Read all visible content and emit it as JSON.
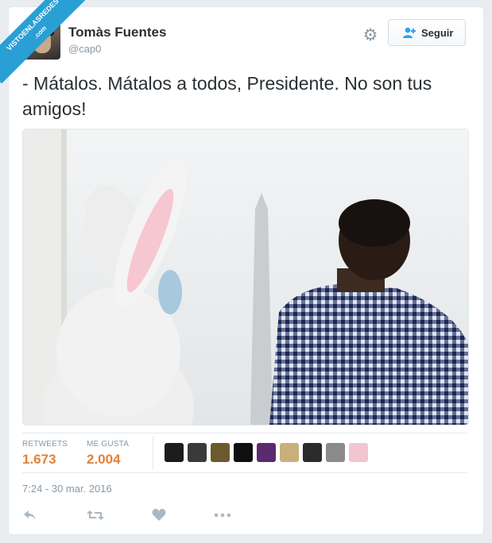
{
  "watermark": {
    "line1": "VISTOENLASREDES",
    "line2": ".com"
  },
  "user": {
    "name": "Tomàs Fuentes",
    "handle": "@cap0"
  },
  "header": {
    "settings_icon": "gear-icon",
    "follow_label": "Seguir",
    "follow_icon": "add-user-icon"
  },
  "tweet": {
    "text": "- Mátalos. Mátalos a todos, Presidente. No son tus amigos!"
  },
  "stats": {
    "retweets_label": "RETWEETS",
    "retweets_value": "1.673",
    "likes_label": "ME GUSTA",
    "likes_value": "2.004"
  },
  "liked_by_avatars": [
    {
      "color": "#1c1c1c"
    },
    {
      "color": "#3a3a3a"
    },
    {
      "color": "#6b5a2e"
    },
    {
      "color": "#0f0f0f"
    },
    {
      "color": "#5b2a6e"
    },
    {
      "color": "#c9b07a"
    },
    {
      "color": "#2b2b2b"
    },
    {
      "color": "#8a8a8a"
    },
    {
      "color": "#f3c4d2"
    }
  ],
  "timestamp": "7:24 - 30 mar. 2016",
  "actions": {
    "reply_icon": "reply-icon",
    "retweet_icon": "retweet-icon",
    "like_icon": "heart-icon",
    "more_icon": "more-icon"
  },
  "colors": {
    "accent": "#e1813a",
    "watermark": "#2a9fd6",
    "muted": "#8899a6"
  }
}
